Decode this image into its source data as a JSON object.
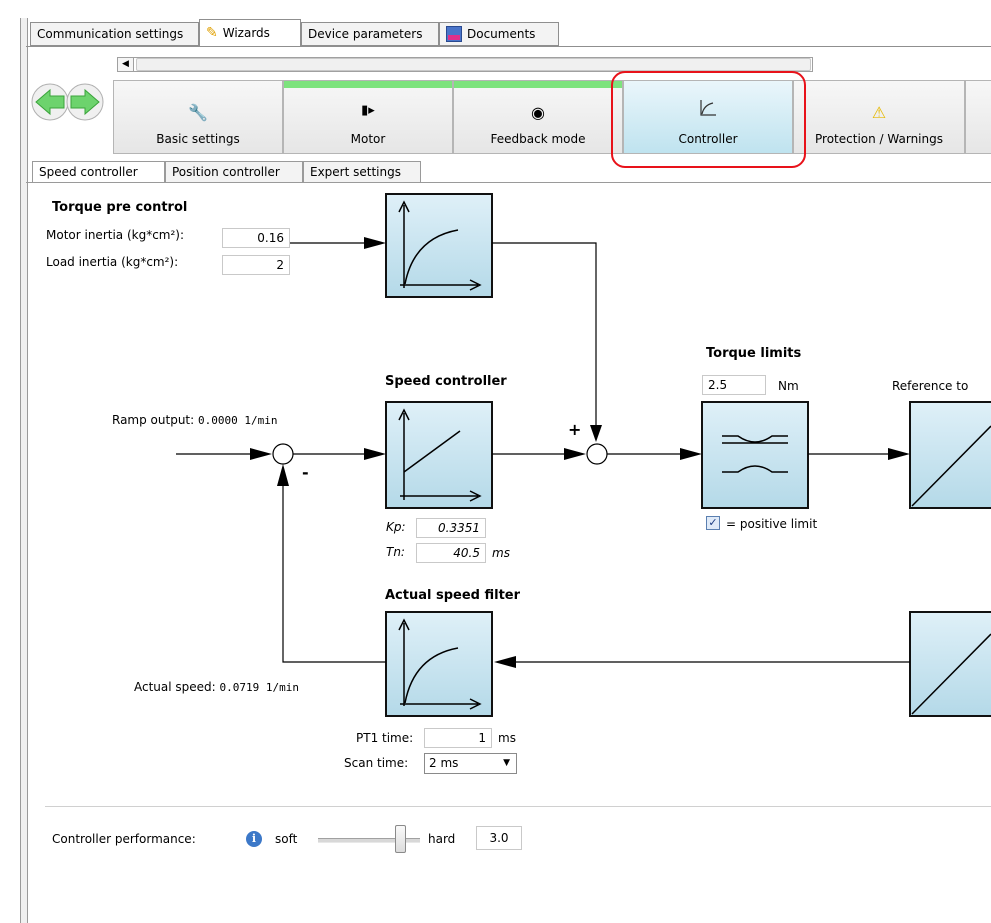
{
  "main_tabs": [
    {
      "label": "Communication settings"
    },
    {
      "label": "Wizards"
    },
    {
      "label": "Device parameters"
    },
    {
      "label": "Documents"
    }
  ],
  "wizard_steps": [
    {
      "label": "Basic settings"
    },
    {
      "label": "Motor"
    },
    {
      "label": "Feedback mode"
    },
    {
      "label": "Controller"
    },
    {
      "label": "Protection / Warnings"
    }
  ],
  "sub_tabs": [
    {
      "label": "Speed controller"
    },
    {
      "label": "Position controller"
    },
    {
      "label": "Expert settings"
    }
  ],
  "torque_pre_control": {
    "title": "Torque pre control",
    "motor_inertia_label": "Motor inertia (kg*cm²):",
    "motor_inertia_value": "0.16",
    "load_inertia_label": "Load inertia (kg*cm²):",
    "load_inertia_value": "2"
  },
  "speed_controller": {
    "title": "Speed controller",
    "ramp_output_label": "Ramp output:",
    "ramp_output_value": "0.0000 1/min",
    "plus": "+",
    "minus": "-",
    "kp_label": "Kp:",
    "kp_value": "0.3351",
    "tn_label": "Tn:",
    "tn_value": "40.5",
    "tn_unit": "ms"
  },
  "torque_limits": {
    "title": "Torque limits",
    "value": "2.5",
    "unit": "Nm",
    "checkbox_label": "= positive limit",
    "reference_label": "Reference to"
  },
  "actual_speed_filter": {
    "title": "Actual speed filter",
    "actual_speed_label": "Actual speed:",
    "actual_speed_value": "0.0719 1/min",
    "pt1_label": "PT1 time:",
    "pt1_value": "1",
    "pt1_unit": "ms",
    "scan_label": "Scan time:",
    "scan_value": "2 ms"
  },
  "performance": {
    "label": "Controller performance:",
    "soft": "soft",
    "hard": "hard",
    "value": "3.0"
  },
  "colors": {
    "highlight": "#e8121a",
    "block_fill": "#c6e4f0",
    "done_bar": "#7de37d",
    "nav_arrow": "#6dd36d"
  },
  "icons": [
    "pencil-icon",
    "document-icon",
    "wrench-icon",
    "motor-icon",
    "feedback-icon",
    "controller-curve-icon",
    "warning-icon",
    "info-icon",
    "back-arrow-icon",
    "forward-arrow-icon",
    "scroll-left-icon",
    "dropdown-arrow-icon"
  ]
}
